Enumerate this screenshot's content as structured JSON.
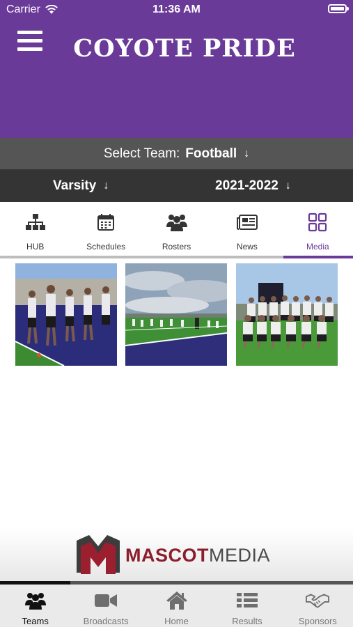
{
  "status_bar": {
    "carrier": "Carrier",
    "time": "11:36 AM"
  },
  "header": {
    "title": "COYOTE PRIDE",
    "background_color": "#6a3a98",
    "menu_icon": "hamburger-menu-icon"
  },
  "team_selector": {
    "label": "Select Team:",
    "value": "Football"
  },
  "filters": {
    "level": "Varsity",
    "season": "2021-2022"
  },
  "tabs": [
    {
      "label": "HUB",
      "icon": "org-chart-icon",
      "active": false
    },
    {
      "label": "Schedules",
      "icon": "calendar-icon",
      "active": false
    },
    {
      "label": "Rosters",
      "icon": "people-group-icon",
      "active": false
    },
    {
      "label": "News",
      "icon": "newspaper-icon",
      "active": false
    },
    {
      "label": "Media",
      "icon": "grid-icon",
      "active": true
    }
  ],
  "media": [
    {
      "icon": "team-huddle-photo"
    },
    {
      "icon": "practice-field-photo"
    },
    {
      "icon": "team-group-photo"
    }
  ],
  "sponsor": {
    "logo_part1": "MASCOT",
    "logo_part2": "MEDIA",
    "brand_color": "#8b1d2c"
  },
  "bottom_nav": [
    {
      "label": "Teams",
      "icon": "people-group-icon",
      "active": true
    },
    {
      "label": "Broadcasts",
      "icon": "video-camera-icon",
      "active": false
    },
    {
      "label": "Home",
      "icon": "home-icon",
      "active": false
    },
    {
      "label": "Results",
      "icon": "list-icon",
      "active": false
    },
    {
      "label": "Sponsors",
      "icon": "handshake-icon",
      "active": false
    }
  ]
}
